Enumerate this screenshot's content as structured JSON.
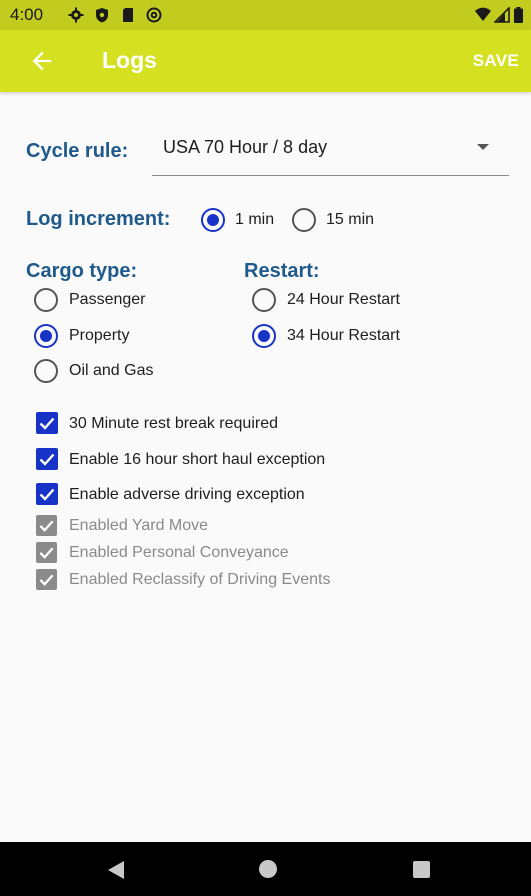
{
  "status_bar": {
    "time": "4:00",
    "icons": [
      "settings-icon",
      "shield-icon",
      "sd-card-icon",
      "at-icon",
      "wifi-icon",
      "signal-icon",
      "battery-icon"
    ]
  },
  "app_bar": {
    "title": "Logs",
    "save_label": "SAVE",
    "back_icon": "arrow-back-icon",
    "color": "#d4e020"
  },
  "cycle_rule": {
    "label": "Cycle rule:",
    "value": "USA 70 Hour / 8 day"
  },
  "log_increment": {
    "label": "Log increment:",
    "options": [
      {
        "label": "1 min",
        "selected": true
      },
      {
        "label": "15 min",
        "selected": false
      }
    ]
  },
  "cargo_type": {
    "label": "Cargo type:",
    "options": [
      {
        "label": "Passenger",
        "selected": false
      },
      {
        "label": "Property",
        "selected": true
      },
      {
        "label": "Oil and Gas",
        "selected": false
      }
    ]
  },
  "restart": {
    "label": "Restart:",
    "options": [
      {
        "label": "24 Hour Restart",
        "selected": false
      },
      {
        "label": "34 Hour Restart",
        "selected": true
      }
    ]
  },
  "options": [
    {
      "label": "30 Minute rest break required",
      "checked": true,
      "enabled": true
    },
    {
      "label": "Enable 16 hour short haul exception",
      "checked": true,
      "enabled": true
    },
    {
      "label": "Enable adverse driving exception",
      "checked": true,
      "enabled": true
    },
    {
      "label": "Enabled Yard Move",
      "checked": true,
      "enabled": false
    },
    {
      "label": "Enabled Personal Conveyance",
      "checked": true,
      "enabled": false
    },
    {
      "label": "Enabled Reclassify of Driving Events",
      "checked": true,
      "enabled": false
    }
  ],
  "colors": {
    "accent": "#1733c7",
    "label": "#1f5a8c",
    "disabled": "#8b8b8b"
  },
  "nav_bar": {
    "buttons": [
      "back-nav-icon",
      "home-nav-icon",
      "recents-nav-icon"
    ]
  }
}
